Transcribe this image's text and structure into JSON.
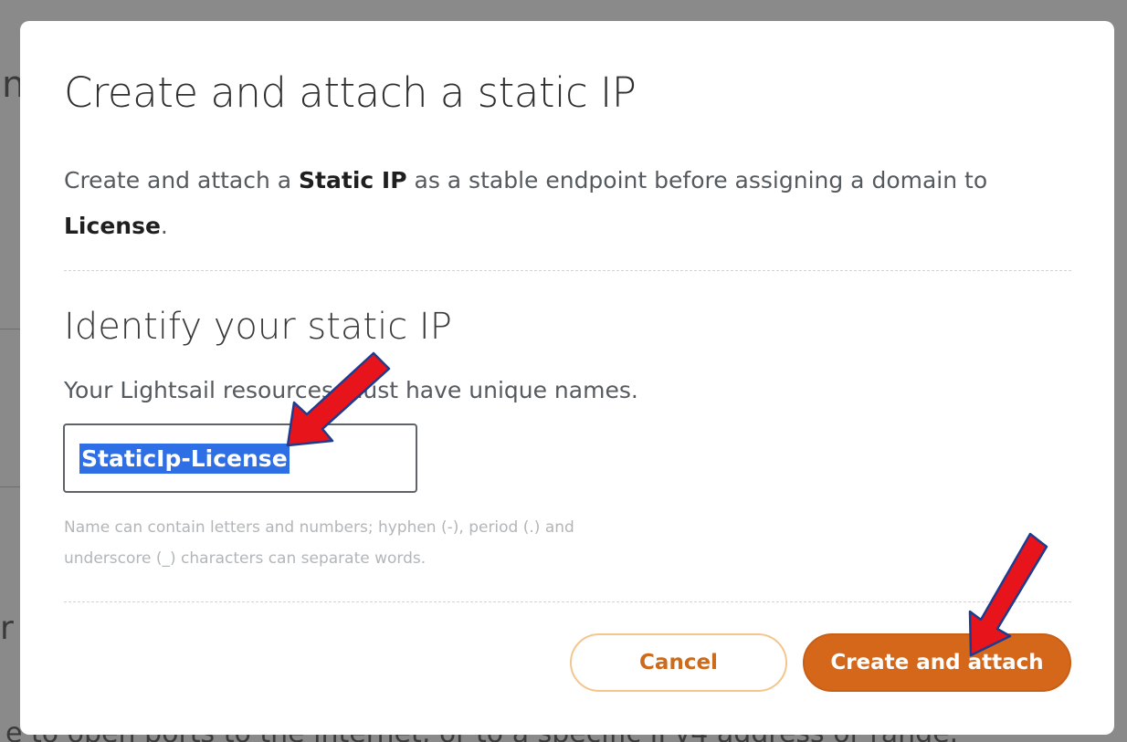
{
  "dialog": {
    "title": "Create and attach a static IP",
    "description": {
      "part1": "Create and attach a ",
      "bold1": "Static IP",
      "part2": " as a stable endpoint before assigning a domain to ",
      "bold2": "License",
      "part3": "."
    },
    "section_title": "Identify your static IP",
    "helper_text": "Your Lightsail resources must have unique names.",
    "name_field": {
      "value": "StaticIp-License"
    },
    "hint_line1": "Name can contain letters and numbers; hyphen (-), period (.) and",
    "hint_line2": "underscore (_) characters can separate words.",
    "cancel_label": "Cancel",
    "submit_label": "Create and attach"
  },
  "background": {
    "bottom_text": "e to open ports to the internet, or to a specific IPv4 address or range."
  },
  "annotation_color": "#e8141b"
}
